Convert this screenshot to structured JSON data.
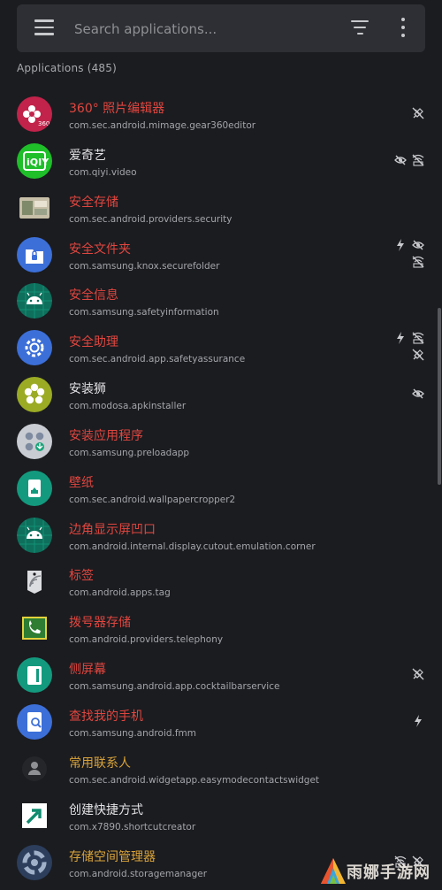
{
  "search": {
    "placeholder": "Search applications..."
  },
  "section": {
    "title": "Applications (485)"
  },
  "watermark": {
    "text": "雨娜手游网"
  },
  "apps": [
    {
      "name": "360° 照片编辑器",
      "pkg": "com.sec.android.mimage.gear360editor",
      "color": "red",
      "icon": "flower-360-icon",
      "flags": [
        "debug-off-icon"
      ]
    },
    {
      "name": "爱奇艺",
      "pkg": "com.qiyi.video",
      "color": "white",
      "icon": "iqiyi-icon",
      "flags": [
        "hidden-icon",
        "no-internet-icon"
      ]
    },
    {
      "name": "安全存储",
      "pkg": "com.sec.android.providers.security",
      "color": "red",
      "icon": "gallery-icon",
      "flags": []
    },
    {
      "name": "安全文件夹",
      "pkg": "com.samsung.knox.securefolder",
      "color": "red",
      "icon": "secure-folder-icon",
      "flags": [
        "battery-icon",
        "hidden-icon",
        "no-internet-icon"
      ]
    },
    {
      "name": "安全信息",
      "pkg": "com.samsung.safetyinformation",
      "color": "red",
      "icon": "android-icon",
      "flags": []
    },
    {
      "name": "安全助理",
      "pkg": "com.sec.android.app.safetyassurance",
      "color": "red",
      "icon": "gear-icon",
      "flags": [
        "battery-icon",
        "no-internet-icon",
        "debug-off-icon"
      ]
    },
    {
      "name": "安装狮",
      "pkg": "com.modosa.apkinstaller",
      "color": "white",
      "icon": "flower-icon",
      "flags": [
        "hidden-icon"
      ]
    },
    {
      "name": "安装应用程序",
      "pkg": "com.samsung.preloadapp",
      "color": "red",
      "icon": "apps-icon",
      "flags": []
    },
    {
      "name": "壁纸",
      "pkg": "com.sec.android.wallpapercropper2",
      "color": "red",
      "icon": "wallpaper-icon",
      "flags": []
    },
    {
      "name": "边角显示屏凹口",
      "pkg": "com.android.internal.display.cutout.emulation.corner",
      "color": "red",
      "icon": "android-icon",
      "flags": []
    },
    {
      "name": "标签",
      "pkg": "com.android.apps.tag",
      "color": "red",
      "icon": "tag-icon",
      "flags": []
    },
    {
      "name": "拨号器存储",
      "pkg": "com.android.providers.telephony",
      "color": "red",
      "icon": "phone-icon",
      "flags": []
    },
    {
      "name": "侧屏幕",
      "pkg": "com.samsung.android.app.cocktailbarservice",
      "color": "red",
      "icon": "edge-screen-icon",
      "flags": [
        "debug-off-icon"
      ]
    },
    {
      "name": "查找我的手机",
      "pkg": "com.samsung.android.fmm",
      "color": "red",
      "icon": "find-phone-icon",
      "flags": [
        "battery-icon"
      ]
    },
    {
      "name": "常用联系人",
      "pkg": "com.sec.android.widgetapp.easymodecontactswidget",
      "color": "orange",
      "icon": "contact-icon",
      "flags": []
    },
    {
      "name": "创建快捷方式",
      "pkg": "com.x7890.shortcutcreator",
      "color": "white",
      "icon": "shortcut-icon",
      "flags": []
    },
    {
      "name": "存储空间管理器",
      "pkg": "com.android.storagemanager",
      "color": "orange",
      "icon": "storage-icon",
      "flags": [
        "no-internet-icon",
        "debug-off-icon"
      ]
    }
  ]
}
